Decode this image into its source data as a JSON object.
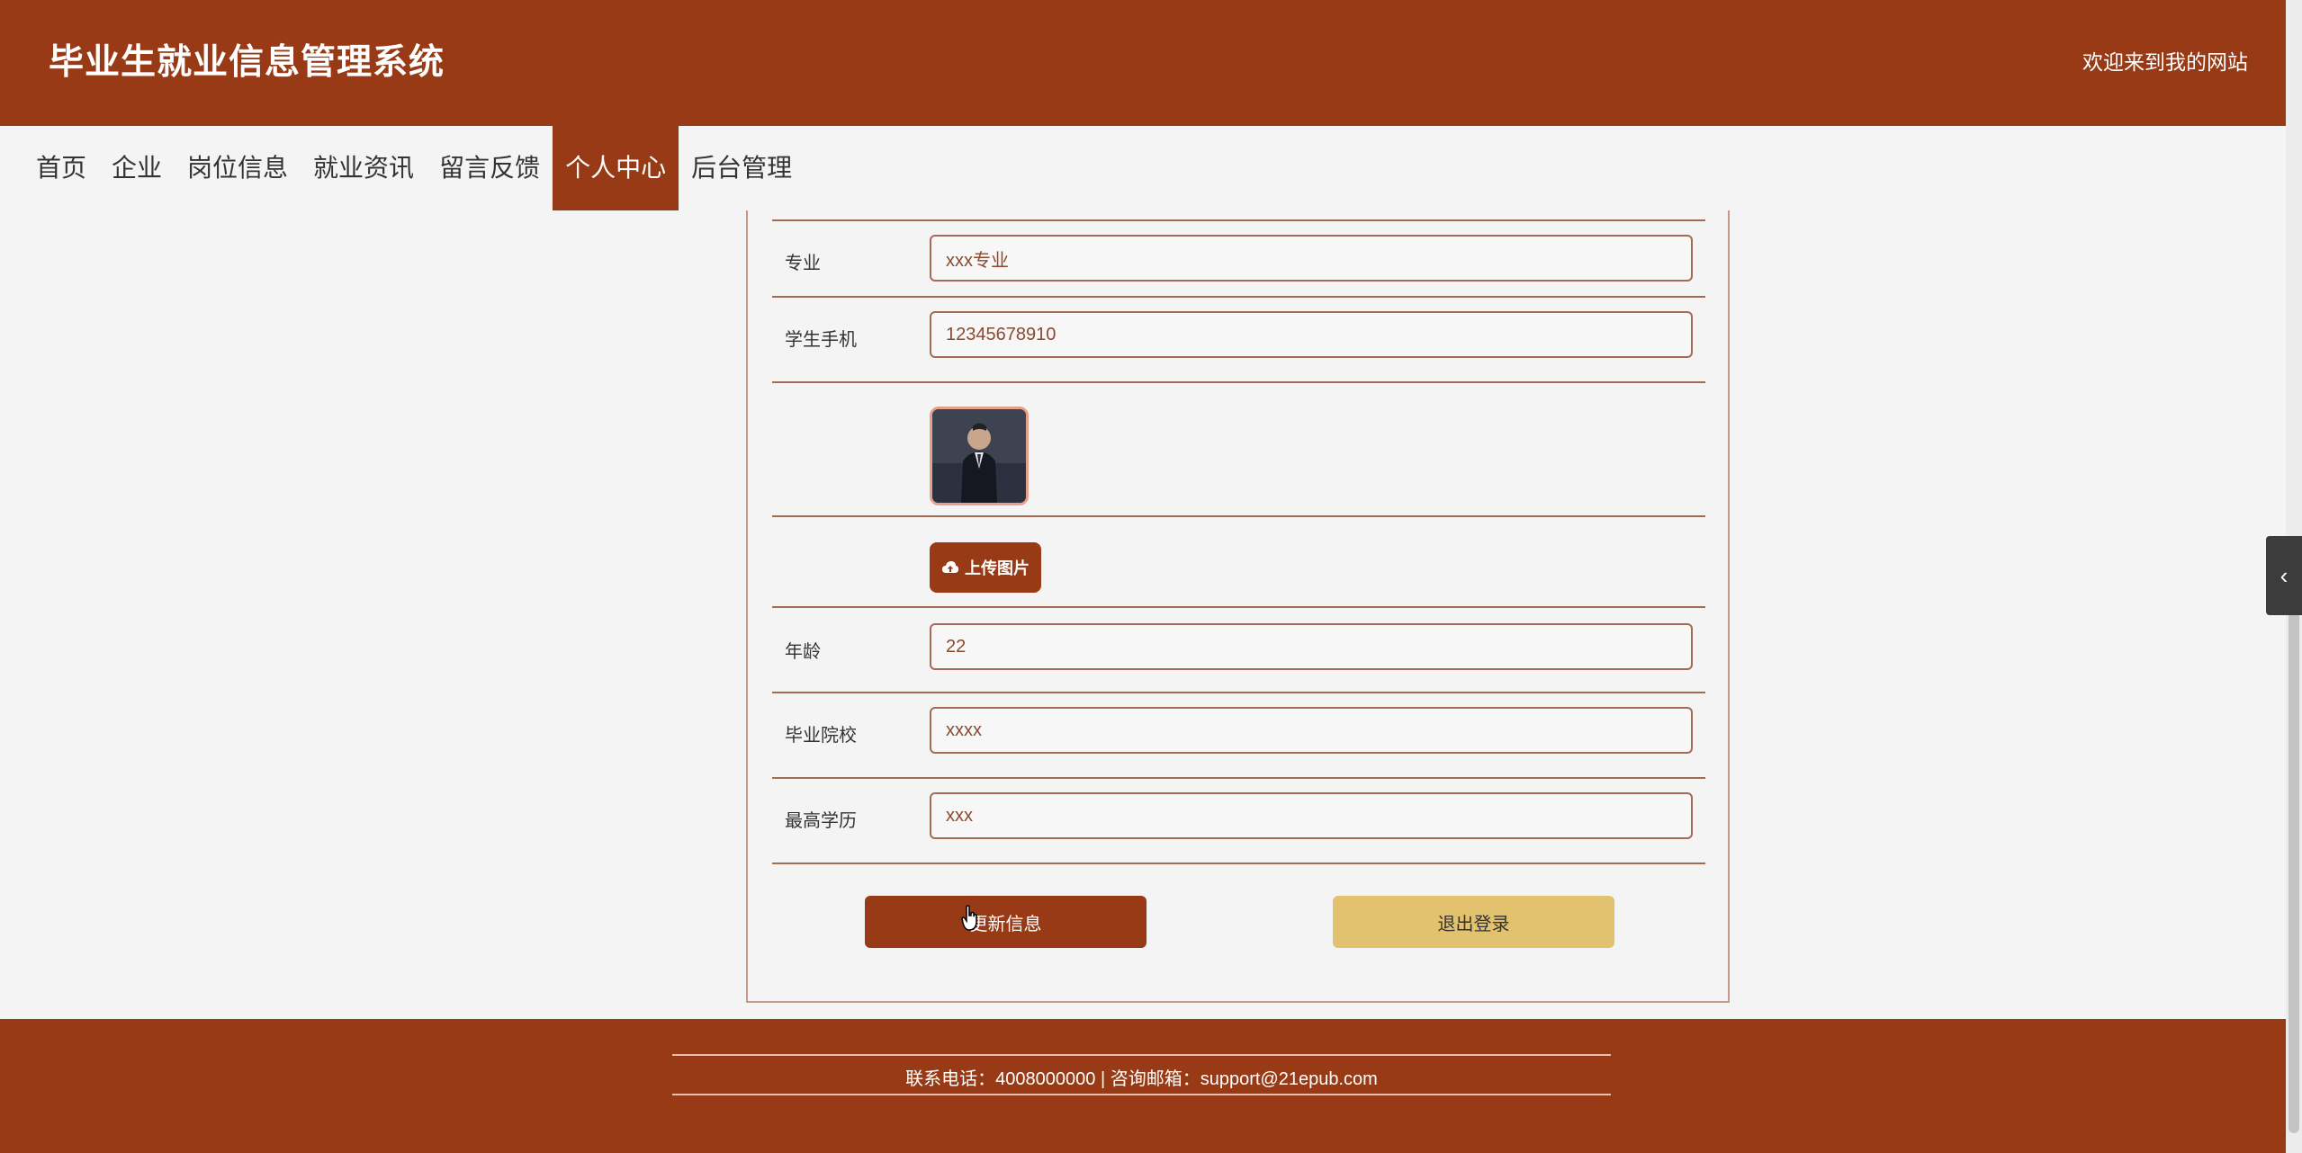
{
  "header": {
    "title": "毕业生就业信息管理系统",
    "welcome": "欢迎来到我的网站"
  },
  "nav": {
    "items": [
      {
        "label": "首页"
      },
      {
        "label": "企业"
      },
      {
        "label": "岗位信息"
      },
      {
        "label": "就业资讯"
      },
      {
        "label": "留言反馈"
      },
      {
        "label": "个人中心",
        "active": true
      },
      {
        "label": "后台管理"
      }
    ]
  },
  "form": {
    "major": {
      "label": "专业",
      "value": "xxx专业"
    },
    "phone": {
      "label": "学生手机",
      "value": "12345678910"
    },
    "avatar": {
      "icon": "avatar-photo"
    },
    "upload": {
      "label": "上传图片",
      "icon": "cloud-upload-icon"
    },
    "age": {
      "label": "年龄",
      "value": "22"
    },
    "school": {
      "label": "毕业院校",
      "value": "xxxx"
    },
    "education": {
      "label": "最高学历",
      "value": "xxx"
    }
  },
  "actions": {
    "update_label": "更新信息",
    "logout_label": "退出登录"
  },
  "footer": {
    "contact": "联系电话：4008000000 | 咨询邮箱：support@21epub.com"
  },
  "colors": {
    "brand": "#983a15",
    "secondary": "#e2c26e",
    "background": "#f4f4f4"
  }
}
